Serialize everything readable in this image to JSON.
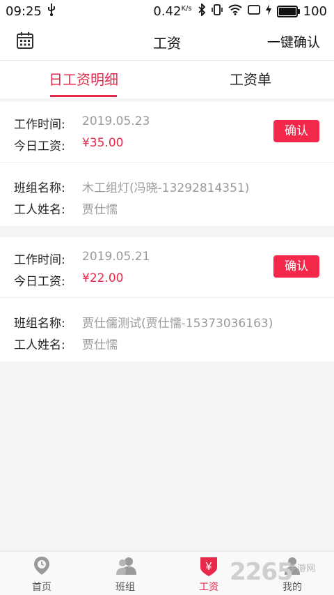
{
  "status_bar": {
    "time": "09:25",
    "net_speed": "0.42",
    "net_unit": "K/s",
    "battery": "100",
    "battery_level": 1.0
  },
  "header": {
    "title": "工资",
    "action": "一键确认",
    "left_icon": "calendar-icon"
  },
  "tabs": [
    {
      "label": "日工资明细",
      "active": true
    },
    {
      "label": "工资单",
      "active": false
    }
  ],
  "records": [
    {
      "time_label": "工作时间:",
      "time_value": "2019.05.23",
      "wage_label": "今日工资:",
      "wage_value": "¥35.00",
      "confirm": "确认",
      "team_label": "班组名称:",
      "team_value": "木工组灯(冯晓-13292814351)",
      "worker_label": "工人姓名:",
      "worker_value": "贾仕懦"
    },
    {
      "time_label": "工作时间:",
      "time_value": "2019.05.21",
      "wage_label": "今日工资:",
      "wage_value": "¥22.00",
      "confirm": "确认",
      "team_label": "班组名称:",
      "team_value": "贾仕儒测试(贾仕懦-15373036163)",
      "worker_label": "工人姓名:",
      "worker_value": "贾仕懦"
    }
  ],
  "bottom_nav": [
    {
      "label": "首页",
      "icon": "location-icon",
      "active": false
    },
    {
      "label": "班组",
      "icon": "team-icon",
      "active": false
    },
    {
      "label": "工资",
      "icon": "wage-shield-icon",
      "active": true
    },
    {
      "label": "我的",
      "icon": "profile-icon",
      "active": false
    }
  ],
  "watermark": {
    "text": "2265",
    "sub": "手游网"
  },
  "colors": {
    "accent": "#e8294a",
    "button": "#f4284b"
  }
}
